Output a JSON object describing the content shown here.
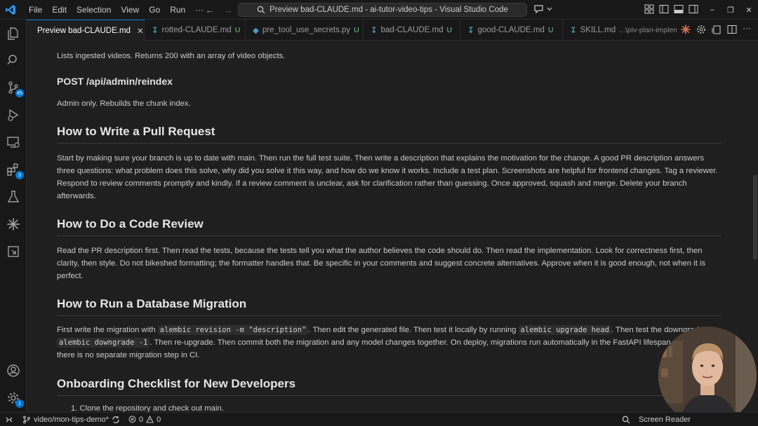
{
  "window": {
    "title": "Preview bad-CLAUDE.md - ai-tutor-video-tips - Visual Studio Code"
  },
  "menu": [
    "File",
    "Edit",
    "Selection",
    "View",
    "Go",
    "Run",
    "···"
  ],
  "activity": [
    {
      "icon": "explorer-icon"
    },
    {
      "icon": "search-icon"
    },
    {
      "icon": "source-control-icon",
      "badge": "45"
    },
    {
      "icon": "run-debug-icon"
    },
    {
      "icon": "remote-explorer-icon"
    },
    {
      "icon": "extensions-icon",
      "badge": "3"
    },
    {
      "icon": "testing-icon"
    },
    {
      "icon": "claude-icon"
    },
    {
      "icon": "pull-requests-icon"
    }
  ],
  "activity_bottom": [
    {
      "icon": "accounts-icon"
    },
    {
      "icon": "manage-gear-icon",
      "badge": "1"
    }
  ],
  "tabs": [
    {
      "label": "Preview bad-CLAUDE.md",
      "active": true,
      "close": "✕"
    },
    {
      "label": "rotted-CLAUDE.md",
      "mod": "U"
    },
    {
      "label": "pre_tool_use_secrets.py",
      "mod": "U"
    },
    {
      "label": "bad-CLAUDE.md",
      "mod": "U"
    },
    {
      "label": "good-CLAUDE.md",
      "mod": "U"
    },
    {
      "label": "SKILL.md",
      "path": "...\\piv-plan-implemen"
    }
  ],
  "doc": {
    "intro": "Lists ingested videos. Returns 200 with an array of video objects.",
    "endpoint_heading": "POST /api/admin/reindex",
    "endpoint_desc": "Admin only. Rebuilds the chunk index.",
    "pr_heading": "How to Write a Pull Request",
    "pr_text": "Start by making sure your branch is up to date with main. Then run the full test suite. Then write a description that explains the motivation for the change. A good PR description answers three questions: what problem does this solve, why did you solve it this way, and how do we know it works. Include a test plan. Screenshots are helpful for frontend changes. Tag a reviewer. Respond to review comments promptly and kindly. If a review comment is unclear, ask for clarification rather than guessing. Once approved, squash and merge. Delete your branch afterwards.",
    "cr_heading": "How to Do a Code Review",
    "cr_text": "Read the PR description first. Then read the tests, because the tests tell you what the author believes the code should do. Then read the implementation. Look for correctness first, then clarity, then style. Do not bikeshed formatting; the formatter handles that. Be specific in your comments and suggest concrete alternatives. Approve when it is good enough, not when it is perfect.",
    "db_heading": "How to Run a Database Migration",
    "db_p1": "First write the migration with ",
    "db_code1": "alembic revision -m \"description\"",
    "db_p2": ". Then edit the generated file. Then test it locally by running ",
    "db_code2": "alembic upgrade head",
    "db_p3": ". Then test the downgrade",
    "db_code3": "alembic downgrade -1",
    "db_p4": ". Then re-upgrade. Then commit both the migration and any model changes together. On deploy, migrations run automatically in the FastAPI lifespan",
    "db_p5": "there is no separate migration step in CI.",
    "onboard_heading": "Onboarding Checklist for New Developers",
    "onboard_item1": "1. Clone the repository and check out main."
  },
  "status": {
    "branch": "video/mon-tips-demo*",
    "errors": "0",
    "warnings": "0",
    "screen_reader": "Screen Reader"
  },
  "colors": {
    "accent": "#0078d4",
    "untracked": "#73c991",
    "claude_orange": "#d97757"
  }
}
